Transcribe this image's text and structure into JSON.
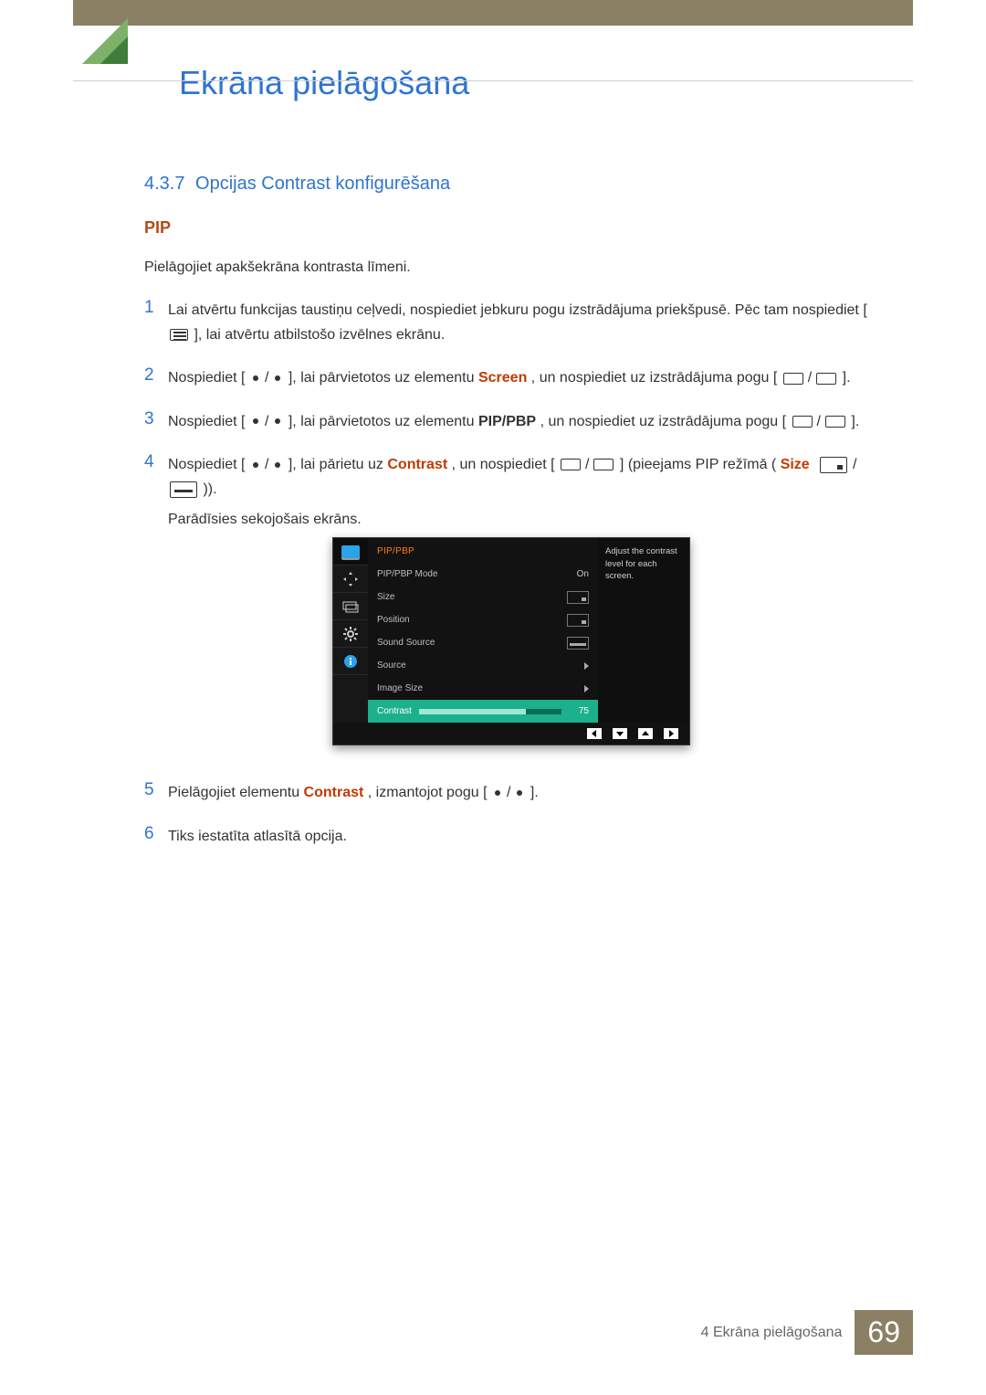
{
  "chapterTitle": "Ekrāna pielāgošana",
  "section": {
    "number": "4.3.7",
    "title": "Opcijas Contrast konfigurēšana"
  },
  "pipTitle": "PIP",
  "intro": "Pielāgojiet apakšekrāna kontrasta līmeni.",
  "steps": {
    "s1": {
      "num": "1",
      "a": "Lai atvērtu funkcijas taustiņu ceļvedi, nospiediet jebkuru pogu izstrādājuma priekšpusē. Pēc tam nospiediet [",
      "b": "], lai atvērtu atbilstošo izvēlnes ekrānu."
    },
    "s2": {
      "num": "2",
      "a": "Nospiediet [",
      "b": "], lai pārvietotos uz elementu ",
      "kw": "Screen",
      "c": ", un nospiediet uz izstrādājuma pogu [",
      "d": "]."
    },
    "s3": {
      "num": "3",
      "a": "Nospiediet [",
      "b": "], lai pārvietotos uz elementu ",
      "kw": "PIP/PBP",
      "c": ", un nospiediet uz izstrādājuma pogu [",
      "d": "]."
    },
    "s4": {
      "num": "4",
      "a": "Nospiediet [",
      "b": "], lai pārietu uz ",
      "kw": "Contrast",
      "c": ", un nospiediet [",
      "d": "] (pieejams PIP režīmā (",
      "size": "Size",
      "e": "/",
      "f": ")).",
      "sub": "Parādīsies sekojošais ekrāns."
    },
    "s5": {
      "num": "5",
      "a": "Pielāgojiet elementu ",
      "kw": "Contrast",
      "b": ", izmantojot pogu [",
      "c": "]."
    },
    "s6": {
      "num": "6",
      "a": "Tiks iestatīta atlasītā opcija."
    }
  },
  "osd": {
    "title": "PIP/PBP",
    "help": "Adjust the contrast level for each screen.",
    "rows": {
      "mode": {
        "label": "PIP/PBP Mode",
        "value": "On"
      },
      "size": {
        "label": "Size"
      },
      "position": {
        "label": "Position"
      },
      "sound": {
        "label": "Sound Source"
      },
      "source": {
        "label": "Source"
      },
      "image": {
        "label": "Image Size"
      },
      "contrast": {
        "label": "Contrast",
        "value": "75"
      }
    }
  },
  "footer": {
    "chapterLine": "4 Ekrāna pielāgošana",
    "pageNumber": "69"
  }
}
